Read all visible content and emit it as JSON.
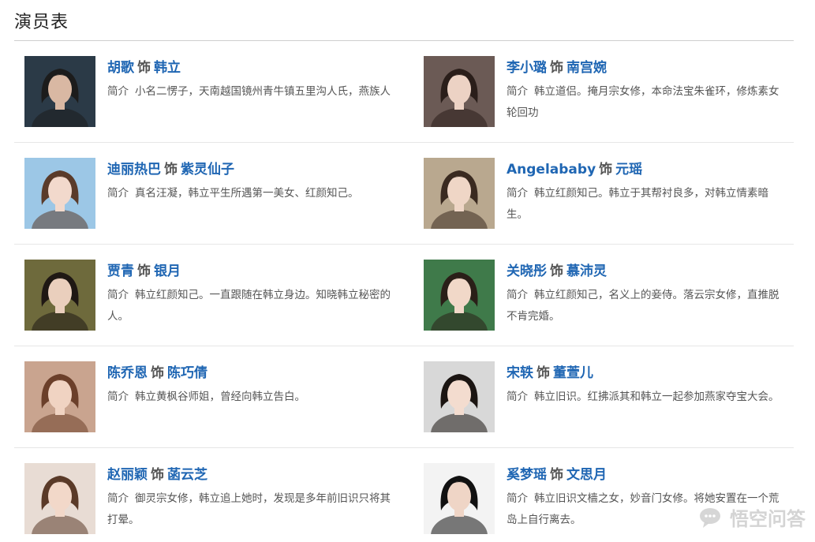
{
  "page": {
    "title": "演员表"
  },
  "cast": [
    {
      "actor": "胡歌",
      "sep": "饰",
      "role": "韩立",
      "desc_label": "简介",
      "desc": "小名二愣子，天南越国镜州青牛镇五里沟人氏，燕族人",
      "photo_bg": "#2b3a47",
      "skin": "#d9b8a3",
      "hair": "#1c1c1c"
    },
    {
      "actor": "李小璐",
      "sep": "饰",
      "role": "南宫婉",
      "desc_label": "简介",
      "desc": "韩立道侣。掩月宗女修，本命法宝朱雀环，修炼素女轮回功",
      "photo_bg": "#6b5a55",
      "skin": "#ecd2c4",
      "hair": "#2a1e1a"
    },
    {
      "actor": "迪丽热巴",
      "sep": "饰",
      "role": "紫灵仙子",
      "desc_label": "简介",
      "desc": "真名汪凝，韩立平生所遇第一美女、红颜知己。",
      "photo_bg": "#9cc7e6",
      "skin": "#f2d9cc",
      "hair": "#5a3b2a"
    },
    {
      "actor": "Angelababy",
      "sep": "饰",
      "role": "元瑶",
      "desc_label": "简介",
      "desc": "韩立红颜知己。韩立于其帮衬良多，对韩立情素暗生。",
      "photo_bg": "#b9a88f",
      "skin": "#efd6c6",
      "hair": "#3a2a20"
    },
    {
      "actor": "贾青",
      "sep": "饰",
      "role": "银月",
      "desc_label": "简介",
      "desc": "韩立红颜知己。一直跟随在韩立身边。知晓韩立秘密的人。",
      "photo_bg": "#6e6a3c",
      "skin": "#eacfbd",
      "hair": "#1f1814"
    },
    {
      "actor": "关晓彤",
      "sep": "饰",
      "role": "慕沛灵",
      "desc_label": "简介",
      "desc": "韩立红颜知己，名义上的妾侍。落云宗女修，直推脱不肯完婚。",
      "photo_bg": "#3f7a4a",
      "skin": "#f1d8c8",
      "hair": "#2a1f18"
    },
    {
      "actor": "陈乔恩",
      "sep": "饰",
      "role": "陈巧倩",
      "desc_label": "简介",
      "desc": "韩立黄枫谷师姐，曾经向韩立告白。",
      "photo_bg": "#c9a48f",
      "skin": "#f0d3c2",
      "hair": "#6b3f2a"
    },
    {
      "actor": "宋轶",
      "sep": "饰",
      "role": "董萱儿",
      "desc_label": "简介",
      "desc": "韩立旧识。红拂派其和韩立一起参加燕家夺宝大会。",
      "photo_bg": "#d8d8d8",
      "skin": "#f3dccf",
      "hair": "#1b1512"
    },
    {
      "actor": "赵丽颖",
      "sep": "饰",
      "role": "菡云芝",
      "desc_label": "简介",
      "desc": "御灵宗女修，韩立追上她时，发现是多年前旧识只将其打晕。",
      "photo_bg": "#e8dcd4",
      "skin": "#f2d8c9",
      "hair": "#5a3a28"
    },
    {
      "actor": "奚梦瑶",
      "sep": "饰",
      "role": "文思月",
      "desc_label": "简介",
      "desc": "韩立旧识文樯之女，妙音门女修。将她安置在一个荒岛上自行离去。",
      "photo_bg": "#f3f3f3",
      "skin": "#efd5c6",
      "hair": "#111111"
    }
  ],
  "watermark": {
    "text": "悟空问答",
    "icon": "chat-bubble-icon"
  }
}
